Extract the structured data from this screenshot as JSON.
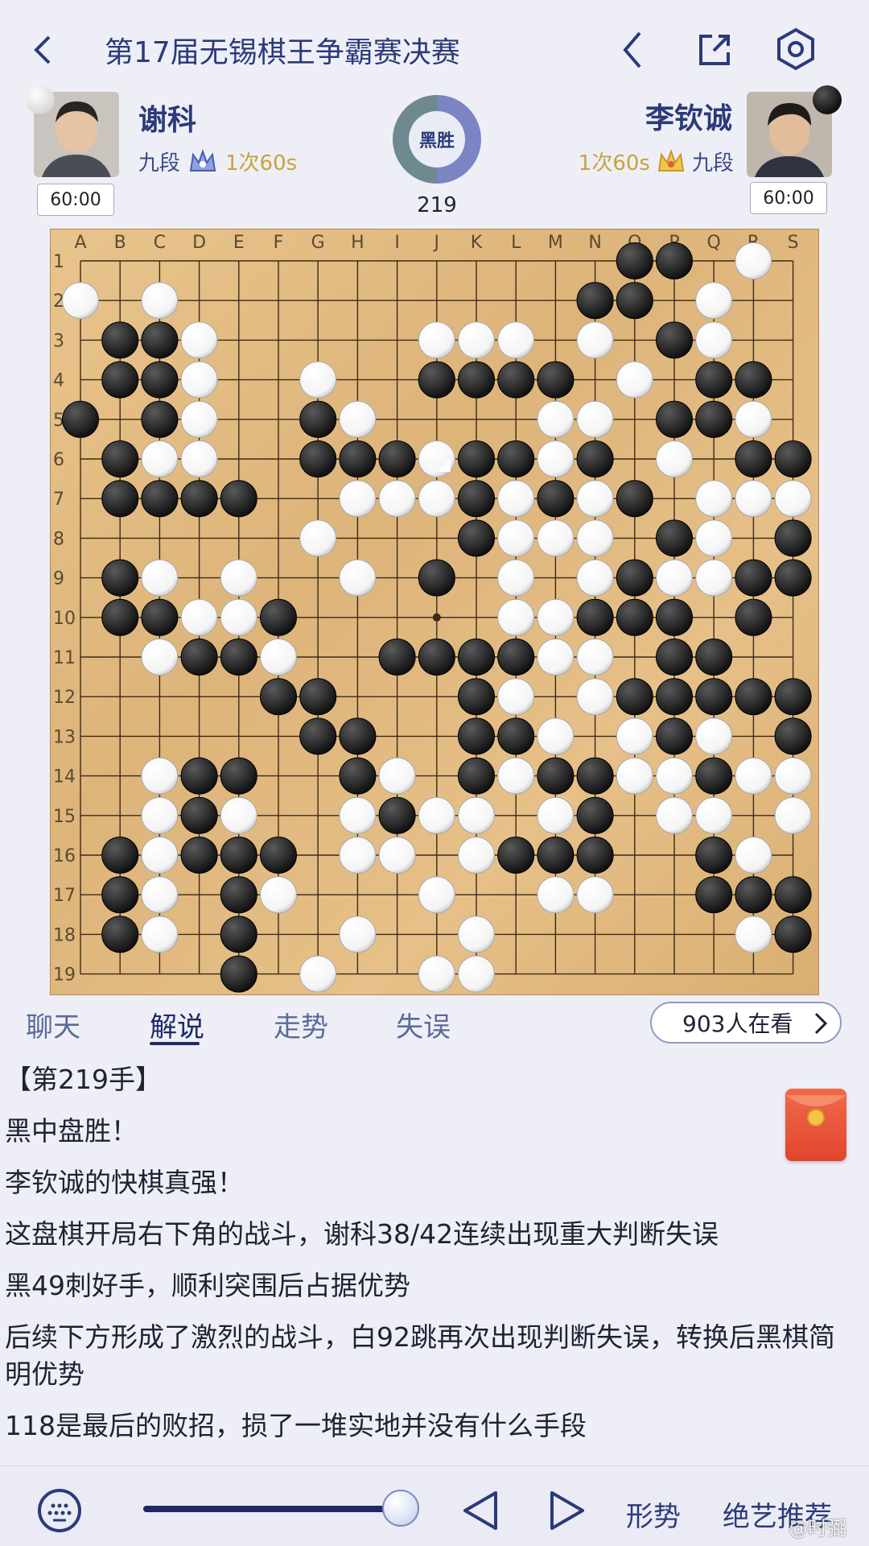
{
  "header": {
    "title": "第17届无锡棋王争霸赛决赛"
  },
  "players": {
    "white": {
      "name": "谢科",
      "rank": "九段",
      "byoyomi": "1次60s",
      "clock": "60:00"
    },
    "black": {
      "name": "李钦诚",
      "rank": "九段",
      "byoyomi": "1次60s",
      "clock": "60:00"
    }
  },
  "result": {
    "badge": "黑胜",
    "move_number": "219"
  },
  "board": {
    "columns": [
      "A",
      "B",
      "C",
      "D",
      "E",
      "F",
      "G",
      "H",
      "I",
      "J",
      "K",
      "L",
      "M",
      "N",
      "O",
      "P",
      "Q",
      "R",
      "S"
    ],
    "rows": [
      "1",
      "2",
      "3",
      "4",
      "5",
      "6",
      "7",
      "8",
      "9",
      "10",
      "11",
      "12",
      "13",
      "14",
      "15",
      "16",
      "17",
      "18",
      "19"
    ],
    "last_move": "J6",
    "star_point": "J10",
    "stones": [
      "..............XB.R.",
      "O.O..........BB.O..",
      ".BXO.....OOO.O.BO..",
      ".XBO..O..XBBB.O.XB.",
      "X.BO..XO....OO.XXO.",
      ".XOO..XXXOXXOX.O.XXX",
      ".XXXX..OOOXOXOB.OOOO",
      "......O...XOOO.XO.X.",
      ".XO.O..O.X.O.OXOOXX.X",
      ".XXOOX.....OOXXX.X.X.",
      "..OXXO..XXXXOO.XX...",
      ".....XX...XO.OXXXXX.",
      "......XX..XXO.OXO.X.",
      "..OXX..XO.XOXXOOXOO.",
      "..OXO..OXOO.OX.OO.O.",
      ".XOXXX.OO.OXXX..XO..O",
      ".XO.XO...O..OO..XXXOO",
      ".XO.X..O..O......OXO.",
      "....X.O..OO.........."
    ],
    "stone_colors": {
      "black": "#111111",
      "white": "#f4f4f4"
    }
  },
  "tabs": [
    {
      "label": "聊天"
    },
    {
      "label": "解说"
    },
    {
      "label": "走势"
    },
    {
      "label": "失误"
    }
  ],
  "viewers": {
    "label": "903人在看"
  },
  "commentary": {
    "heading": "【第219手】",
    "lines": [
      "黑中盘胜！",
      "李钦诚的快棋真强！",
      "这盘棋开局右下角的战斗，谢科38/42连续出现重大判断失误",
      "黑49刺好手，顺利突围后占据优势",
      "后续下方形成了激烈的战斗，白92跳再次出现判断失误，转换后黑棋简明优势",
      "118是最后的败招，损了一堆实地并没有什么手段"
    ]
  },
  "footer": {
    "progress": 1.0,
    "situation_label": "形势",
    "recommend_label": "绝艺推荐",
    "watermark": "@时弼"
  },
  "colors": {
    "accent": "#2b3a7a",
    "progress": "#1f2a66",
    "gold": "#c8a23c"
  }
}
